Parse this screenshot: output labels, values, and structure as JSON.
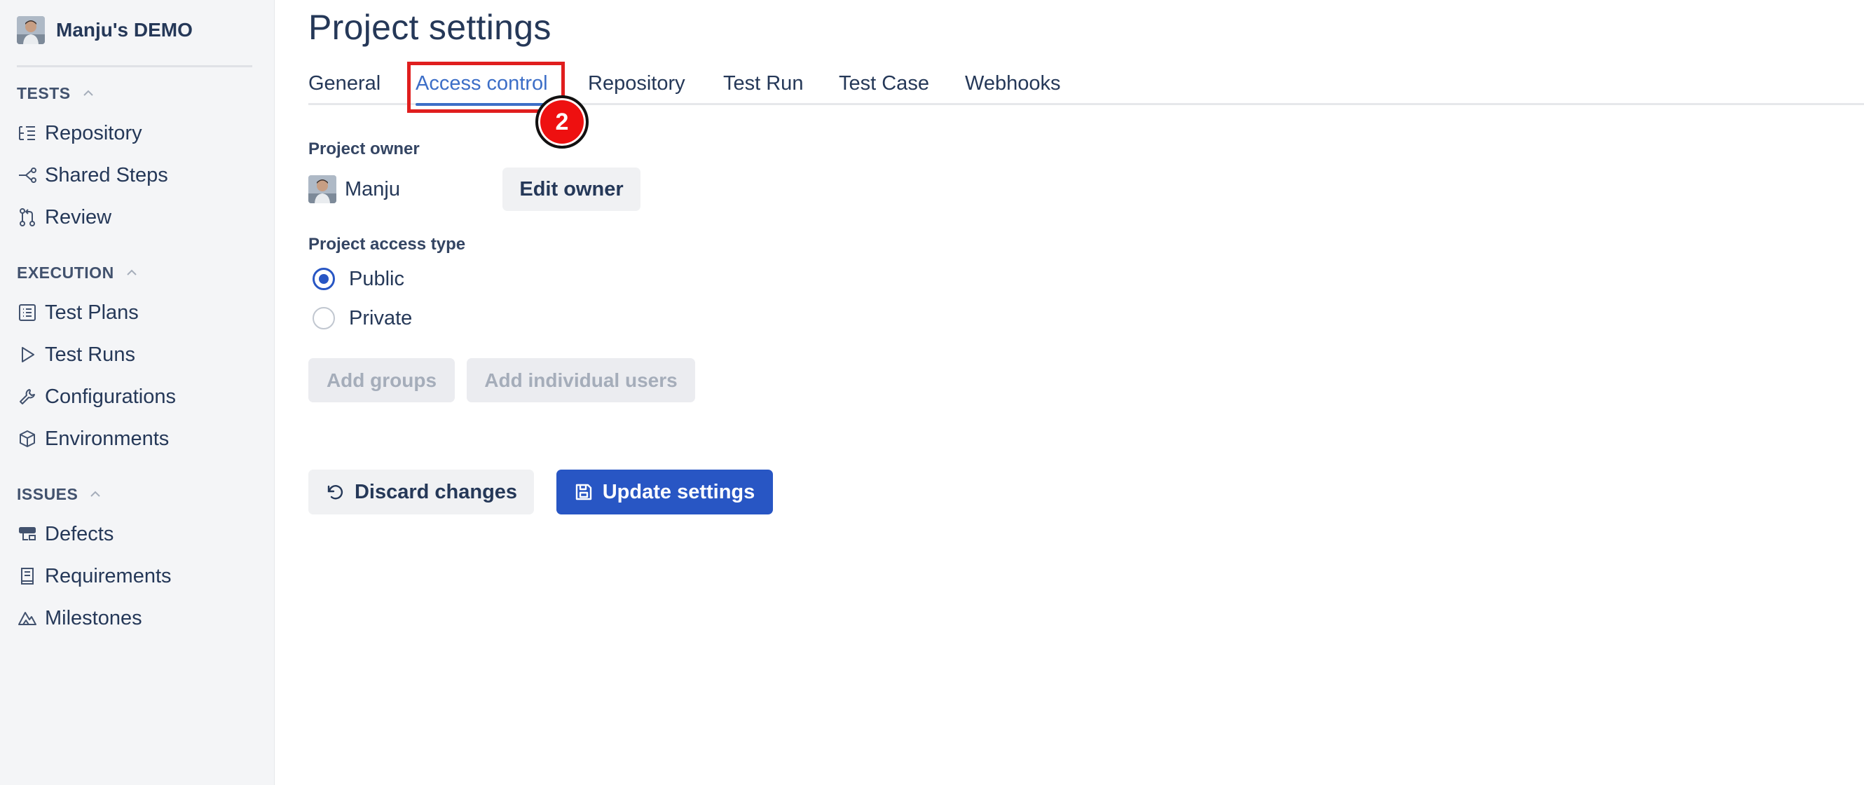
{
  "sidebar": {
    "project_name": "Manju's DEMO",
    "sections": [
      {
        "title": "TESTS",
        "items": [
          {
            "label": "Repository",
            "icon": "repository-icon"
          },
          {
            "label": "Shared Steps",
            "icon": "shared-steps-icon"
          },
          {
            "label": "Review",
            "icon": "review-icon"
          }
        ]
      },
      {
        "title": "EXECUTION",
        "items": [
          {
            "label": "Test Plans",
            "icon": "test-plans-icon"
          },
          {
            "label": "Test Runs",
            "icon": "play-icon"
          },
          {
            "label": "Configurations",
            "icon": "wrench-icon"
          },
          {
            "label": "Environments",
            "icon": "cube-icon"
          }
        ]
      },
      {
        "title": "ISSUES",
        "items": [
          {
            "label": "Defects",
            "icon": "defects-icon"
          },
          {
            "label": "Requirements",
            "icon": "requirements-icon"
          },
          {
            "label": "Milestones",
            "icon": "milestone-icon"
          }
        ]
      }
    ]
  },
  "main": {
    "title": "Project settings",
    "tabs": [
      {
        "label": "General",
        "active": false
      },
      {
        "label": "Access control",
        "active": true
      },
      {
        "label": "Repository",
        "active": false
      },
      {
        "label": "Test Run",
        "active": false
      },
      {
        "label": "Test Case",
        "active": false
      },
      {
        "label": "Webhooks",
        "active": false
      }
    ],
    "step_badge": "2",
    "project_owner": {
      "label": "Project owner",
      "name": "Manju",
      "edit_button": "Edit owner"
    },
    "access_type": {
      "label": "Project access type",
      "options": [
        {
          "label": "Public",
          "checked": true
        },
        {
          "label": "Private",
          "checked": false
        }
      ]
    },
    "add_groups_button": "Add groups",
    "add_users_button": "Add individual users",
    "discard_button": "Discard changes",
    "update_button": "Update settings"
  },
  "colors": {
    "primary": "#2856c4",
    "active_tab": "#3c6ec7",
    "highlight": "#e01e1e",
    "sidebar_bg": "#f4f5f7"
  }
}
